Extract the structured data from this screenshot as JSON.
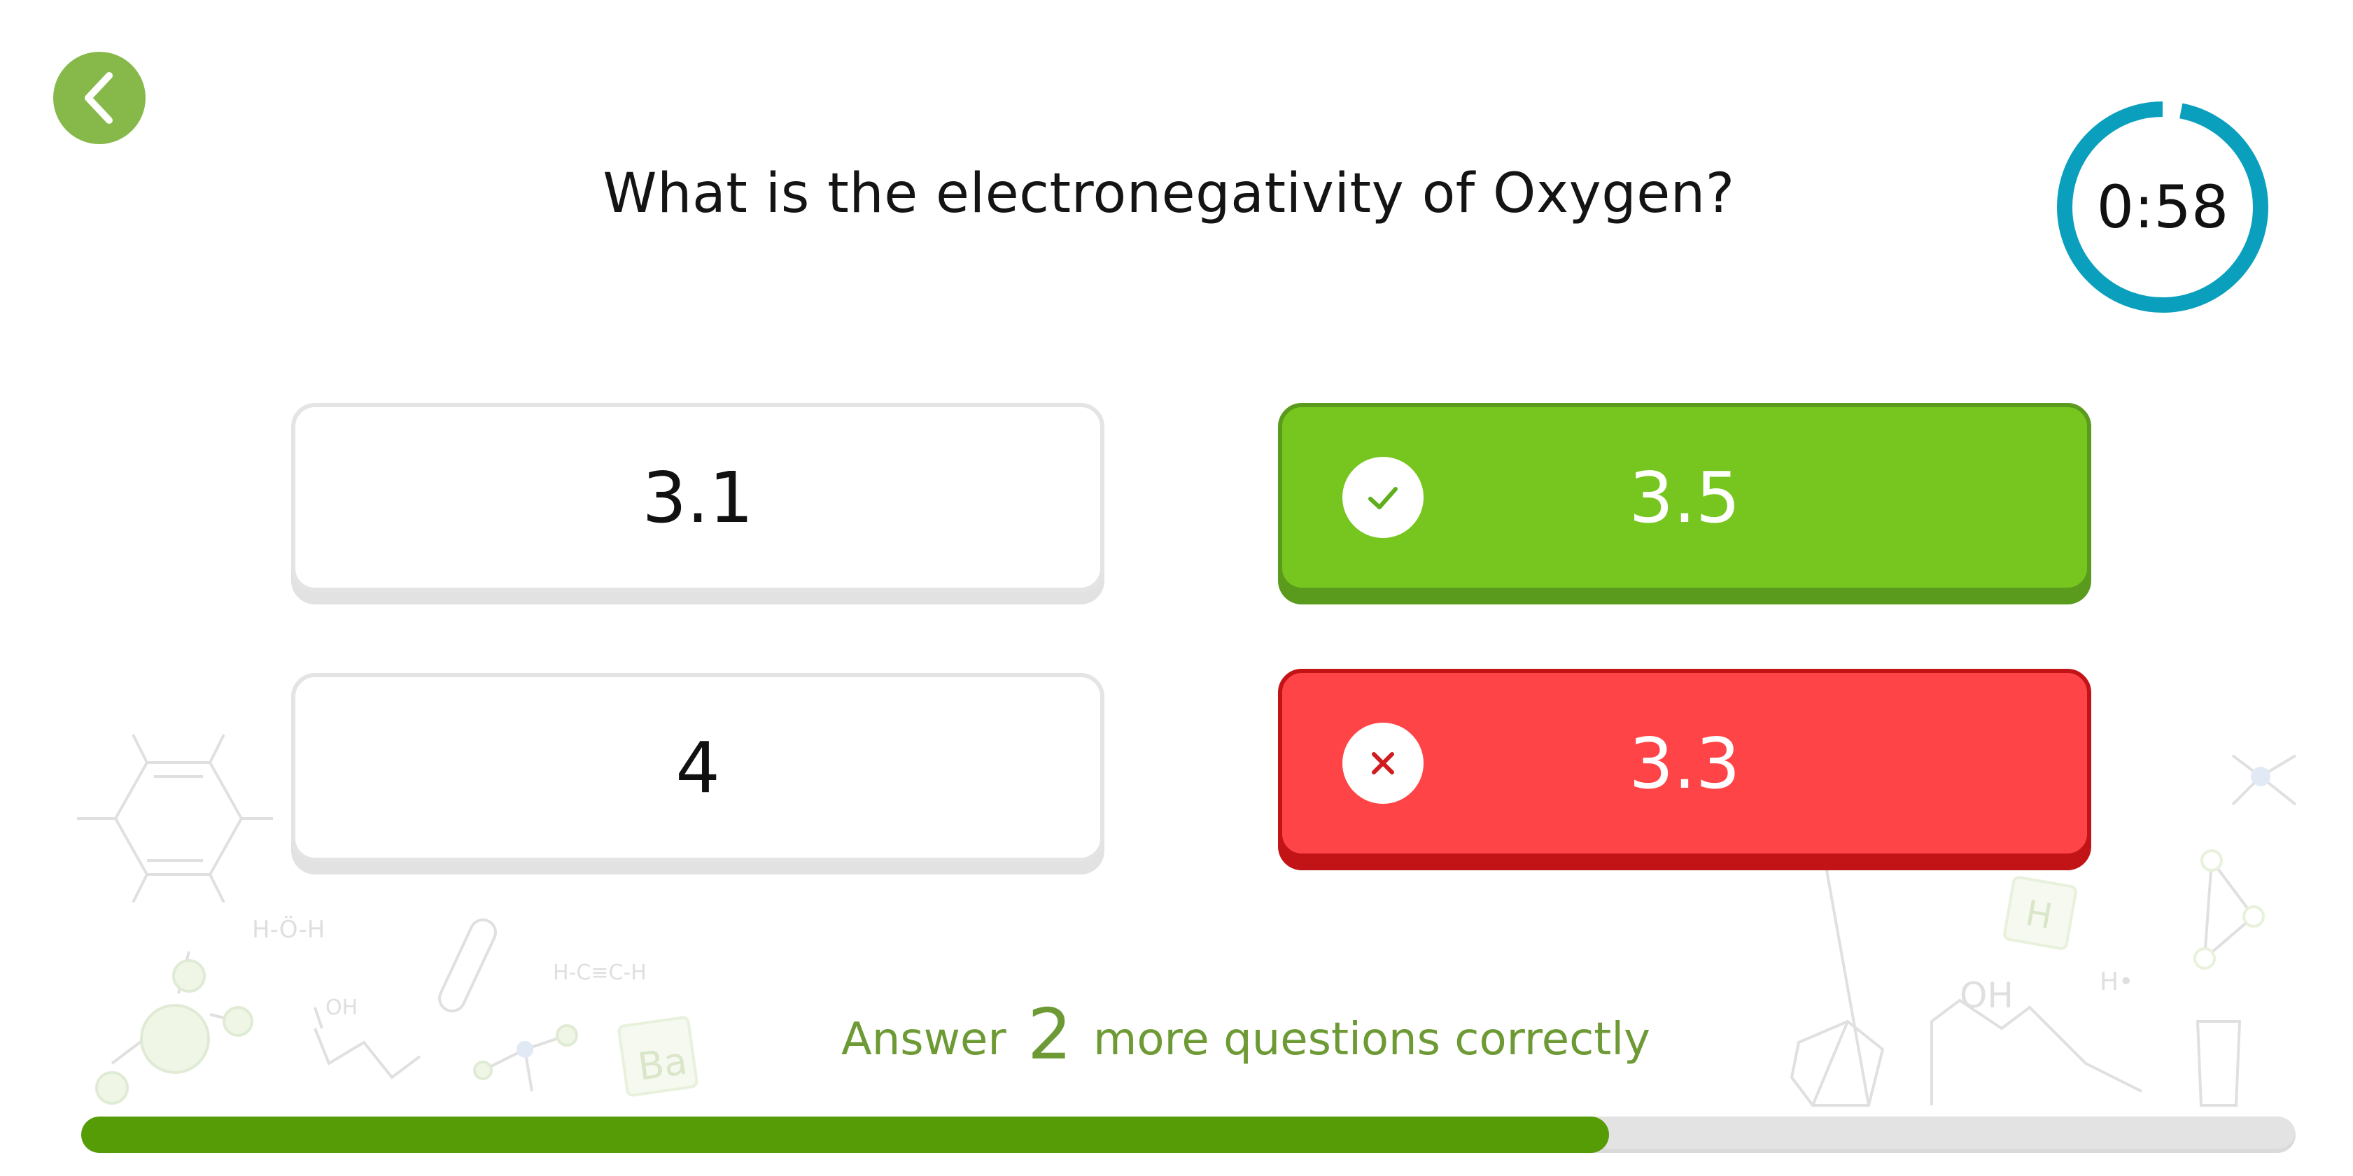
{
  "header": {
    "question": "What is the electronegativity of Oxygen?",
    "timer": {
      "text": "0:58",
      "remaining_fraction": 0.97,
      "ring_color": "#0aa0bd"
    },
    "back_icon": "chevron-left-icon"
  },
  "answers": [
    {
      "label": "3.1",
      "state": "default"
    },
    {
      "label": "3.5",
      "state": "correct",
      "icon": "check-icon"
    },
    {
      "label": "4",
      "state": "default"
    },
    {
      "label": "3.3",
      "state": "incorrect",
      "icon": "x-icon"
    }
  ],
  "progress": {
    "prefix": "Answer",
    "count": "2",
    "suffix": "more questions correctly",
    "fraction": 0.69,
    "fill_color": "#569c07"
  },
  "decorations": {
    "formulas": [
      "H-Ö-H",
      "H-C≡C-H",
      "OH",
      "H•"
    ],
    "element_tiles": [
      "Ba",
      "H"
    ]
  },
  "colors": {
    "accent_green": "#86b94a",
    "correct": "#77c61f",
    "incorrect": "#ff4447",
    "label_green": "#6d9a35"
  }
}
